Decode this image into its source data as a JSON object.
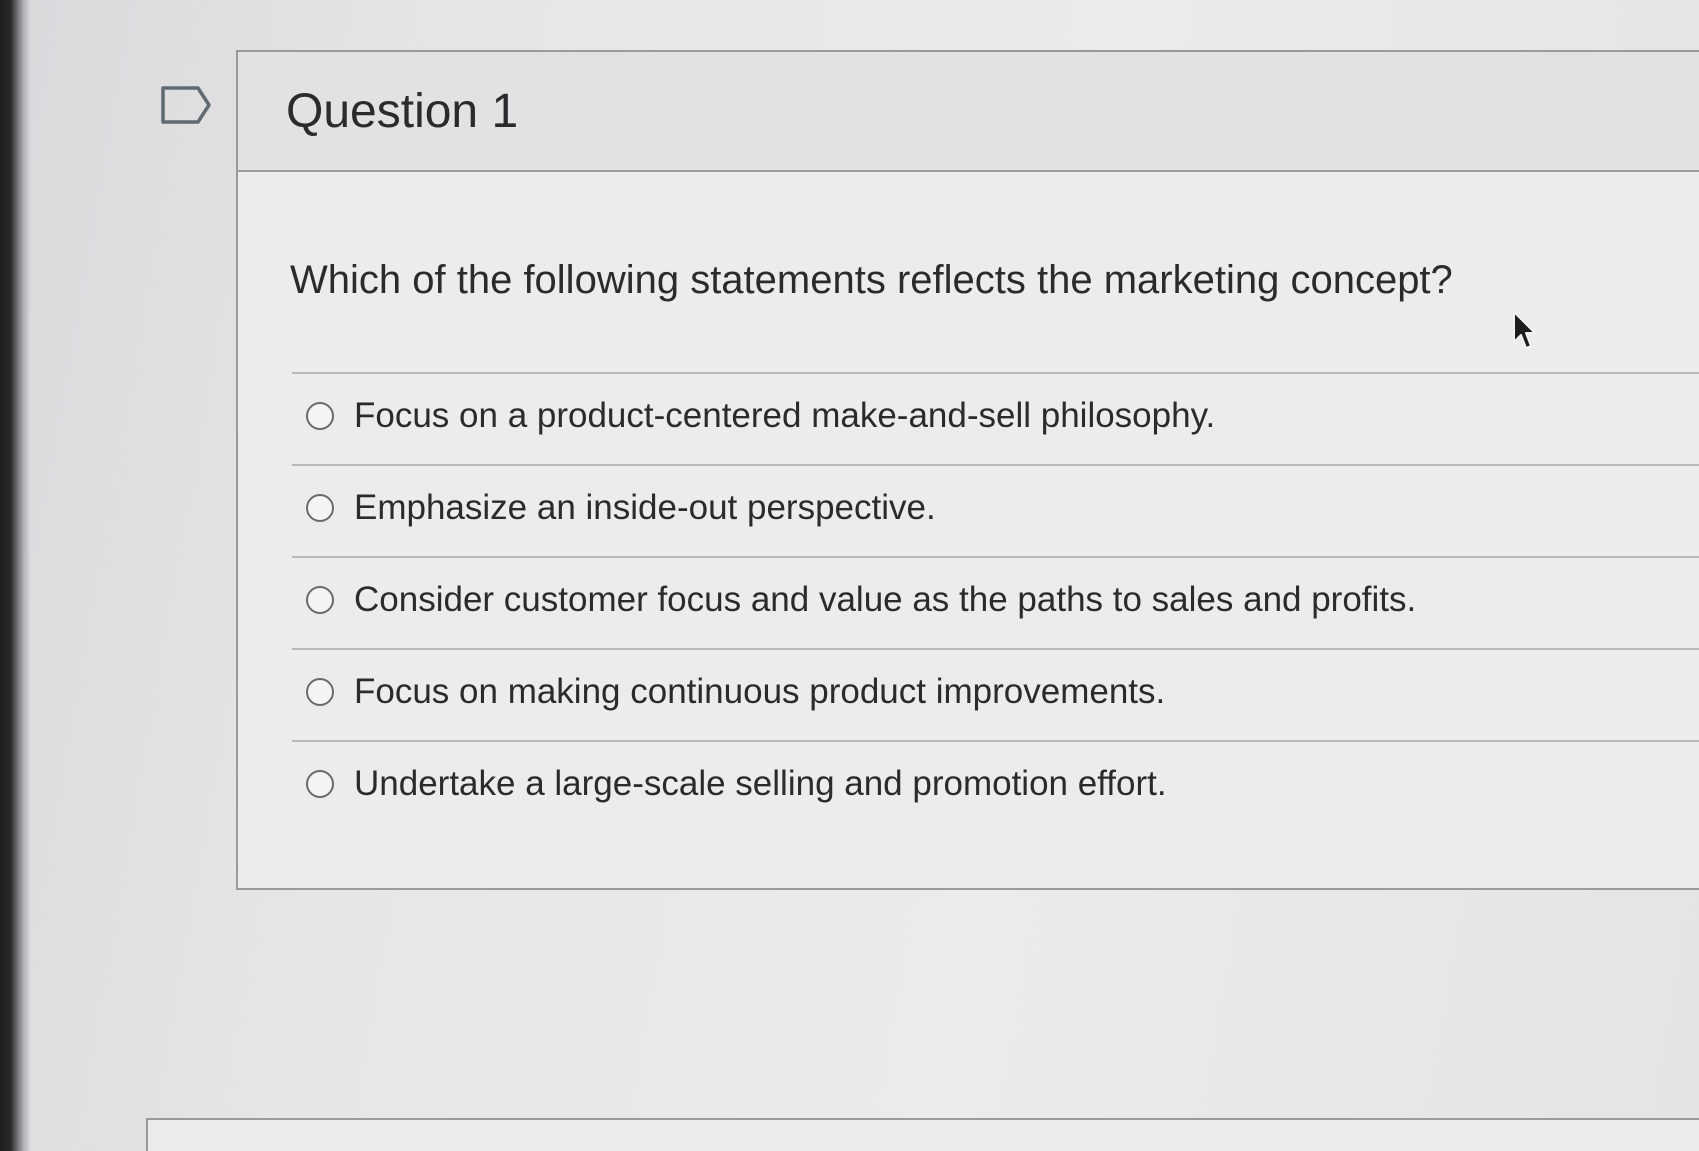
{
  "question": {
    "title": "Question 1",
    "prompt": "Which of the following statements reflects the marketing concept?",
    "options": [
      {
        "label": "Focus on a product-centered make-and-sell philosophy."
      },
      {
        "label": "Emphasize an inside-out perspective."
      },
      {
        "label": "Consider customer focus and value as the paths to sales and profits."
      },
      {
        "label": "Focus on making continuous product improvements."
      },
      {
        "label": "Undertake a large-scale selling and promotion effort."
      }
    ]
  },
  "icons": {
    "flag": "flag-icon",
    "cursor": "mouse-pointer-icon",
    "radio": "radio-unselected"
  },
  "colors": {
    "text": "#2b2b2e",
    "border": "#9a9a9c",
    "header_bg": "#e2e2e4"
  }
}
